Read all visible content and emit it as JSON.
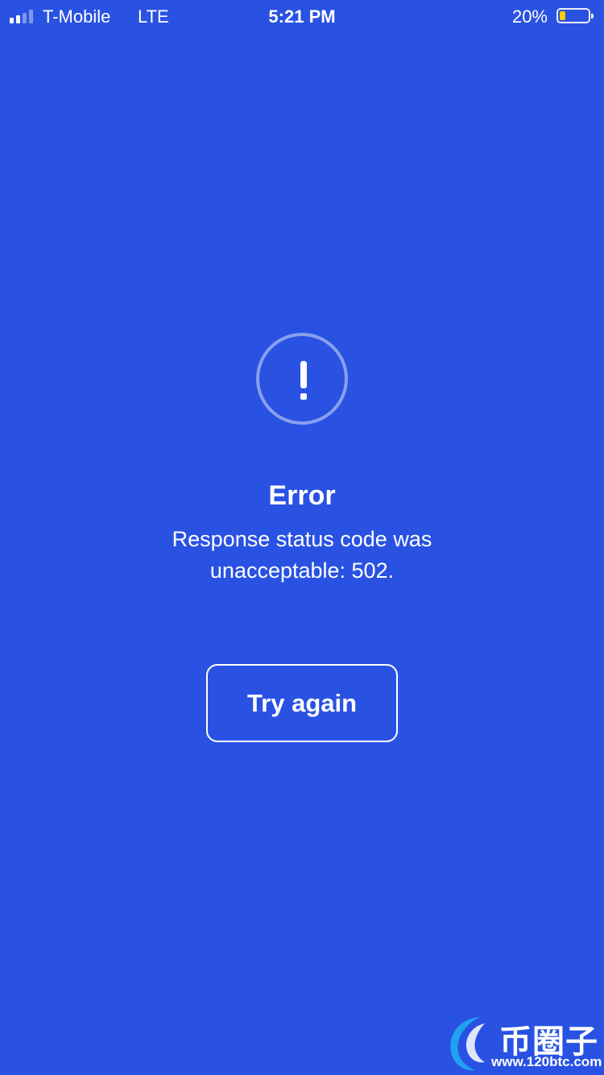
{
  "status_bar": {
    "carrier": "T-Mobile",
    "network": "LTE",
    "time": "5:21 PM",
    "battery": "20%",
    "battery_level": 0.2,
    "battery_color": "#ffcc00"
  },
  "error": {
    "icon": "exclamation-circle-icon",
    "title": "Error",
    "message": "Response status code was unacceptable: 502."
  },
  "actions": {
    "try_again_label": "Try again"
  },
  "watermark": {
    "name": "币圈子",
    "url": "www.120btc.com"
  },
  "colors": {
    "background": "#2952e3",
    "text": "#ffffff"
  }
}
